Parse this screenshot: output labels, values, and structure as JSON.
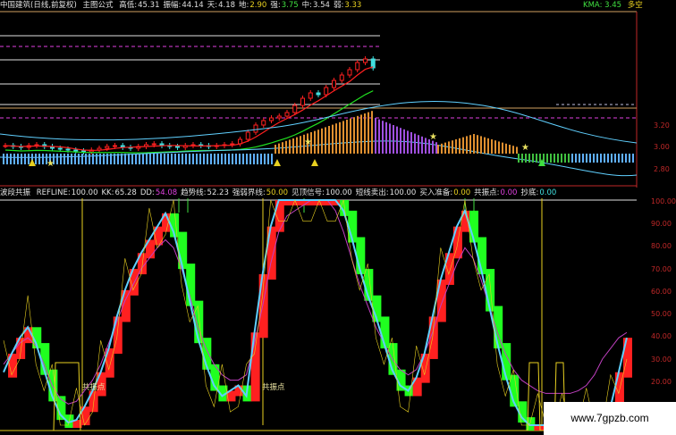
{
  "top_header": {
    "symbol": "中国建筑(日线,前复权)",
    "formula": "主图公式",
    "items": [
      {
        "label": "高低:",
        "value": "45.31",
        "color": "#e0e0e0"
      },
      {
        "label": "振幅:",
        "value": "44.14",
        "color": "#e0e0e0"
      },
      {
        "label": "天:",
        "value": "4.18",
        "color": "#e0e0e0"
      },
      {
        "label": "地:",
        "value": "2.90",
        "color": "#e8d020"
      },
      {
        "label": "强:",
        "value": "3.75",
        "color": "#40e040"
      },
      {
        "label": "中:",
        "value": "3.54",
        "color": "#e0e0e0"
      },
      {
        "label": "弱:",
        "value": "3.33",
        "color": "#e8d020"
      }
    ],
    "kma": "KMA: 3.45",
    "trend": "多空"
  },
  "bottom_header": {
    "title": "波段共振",
    "items": [
      {
        "label": "REFLINE:",
        "value": "100.00",
        "color": "#e0e0e0"
      },
      {
        "label": "KK:",
        "value": "65.28",
        "color": "#e0e0e0"
      },
      {
        "label": "DD:",
        "value": "54.08",
        "color": "#e040e0"
      },
      {
        "label": "趋势线:",
        "value": "52.23",
        "color": "#e0e0e0"
      },
      {
        "label": "强弱界线:",
        "value": "50.00",
        "color": "#e8d020"
      },
      {
        "label": "见顶信号:",
        "value": "100.00",
        "color": "#e0e0e0"
      },
      {
        "label": "短线卖出:",
        "value": "100.00",
        "color": "#e0e0e0"
      },
      {
        "label": "买入准备:",
        "value": "0.00",
        "color": "#e8d020"
      },
      {
        "label": "共振点:",
        "value": "0.00",
        "color": "#e040e0"
      },
      {
        "label": "抄底:",
        "value": "0.00",
        "color": "#40e0e0"
      }
    ]
  },
  "price_axis": [
    "3.20",
    "3.00",
    "2.80"
  ],
  "osc_axis": [
    "100.00",
    "90.00",
    "80.00",
    "70.00",
    "60.00",
    "50.00",
    "40.00",
    "30.00",
    "20.00"
  ],
  "annotations": [
    "共振点",
    "共振点"
  ],
  "watermark": "www.7gpzb.com",
  "colors": {
    "up": "#ff2020",
    "down": "#20ff20",
    "kk": "#60d0ff",
    "dd": "#c040c0",
    "yellow": "#e8d020"
  },
  "chart_data": [
    {
      "type": "line",
      "name": "price-panel",
      "ylim": [
        2.7,
        3.35
      ],
      "close": [
        3.05,
        3.04,
        3.03,
        3.05,
        3.06,
        3.04,
        3.02,
        3.01,
        3.0,
        2.99,
        2.98,
        3.0,
        3.02,
        3.04,
        3.05,
        3.03,
        3.02,
        3.04,
        3.06,
        3.07,
        3.05,
        3.04,
        3.03,
        3.05,
        3.06,
        3.05,
        3.04,
        3.05,
        3.06,
        3.07,
        3.12,
        3.2,
        3.28,
        3.33,
        3.36,
        3.38,
        3.42,
        3.5,
        3.58,
        3.64,
        3.62,
        3.7,
        3.78,
        3.84,
        3.9,
        3.98,
        4.02,
        3.92
      ]
    },
    {
      "type": "line",
      "name": "oscillator-panel",
      "ylim": [
        15,
        105
      ],
      "kk": [
        35,
        42,
        48,
        52,
        46,
        36,
        26,
        19,
        16,
        17,
        22,
        28,
        35,
        44,
        56,
        66,
        74,
        80,
        85,
        90,
        95,
        88,
        76,
        62,
        48,
        38,
        30,
        26,
        28,
        30,
        26,
        50,
        72,
        90,
        100,
        100,
        100,
        100,
        100,
        100,
        100,
        100,
        96,
        86,
        74,
        64,
        56,
        46,
        36,
        30,
        28,
        33,
        42,
        56,
        70,
        80,
        90,
        96,
        86,
        74,
        60,
        46,
        34,
        24,
        18,
        15,
        15,
        15,
        15,
        15,
        15,
        15,
        17,
        18,
        20,
        22,
        35,
        48
      ],
      "dd": [
        38,
        42,
        46,
        48,
        45,
        38,
        30,
        25,
        23,
        24,
        28,
        32,
        38,
        46,
        54,
        62,
        68,
        74,
        78,
        82,
        85,
        82,
        74,
        64,
        52,
        44,
        38,
        34,
        32,
        32,
        34,
        46,
        60,
        76,
        88,
        94,
        96,
        98,
        100,
        100,
        100,
        96,
        88,
        78,
        68,
        60,
        52,
        46,
        40,
        36,
        34,
        36,
        42,
        50,
        60,
        68,
        76,
        82,
        78,
        70,
        60,
        50,
        42,
        36,
        32,
        30,
        28,
        27,
        27,
        27,
        27,
        28,
        30,
        34,
        40,
        44,
        48,
        50
      ]
    }
  ]
}
